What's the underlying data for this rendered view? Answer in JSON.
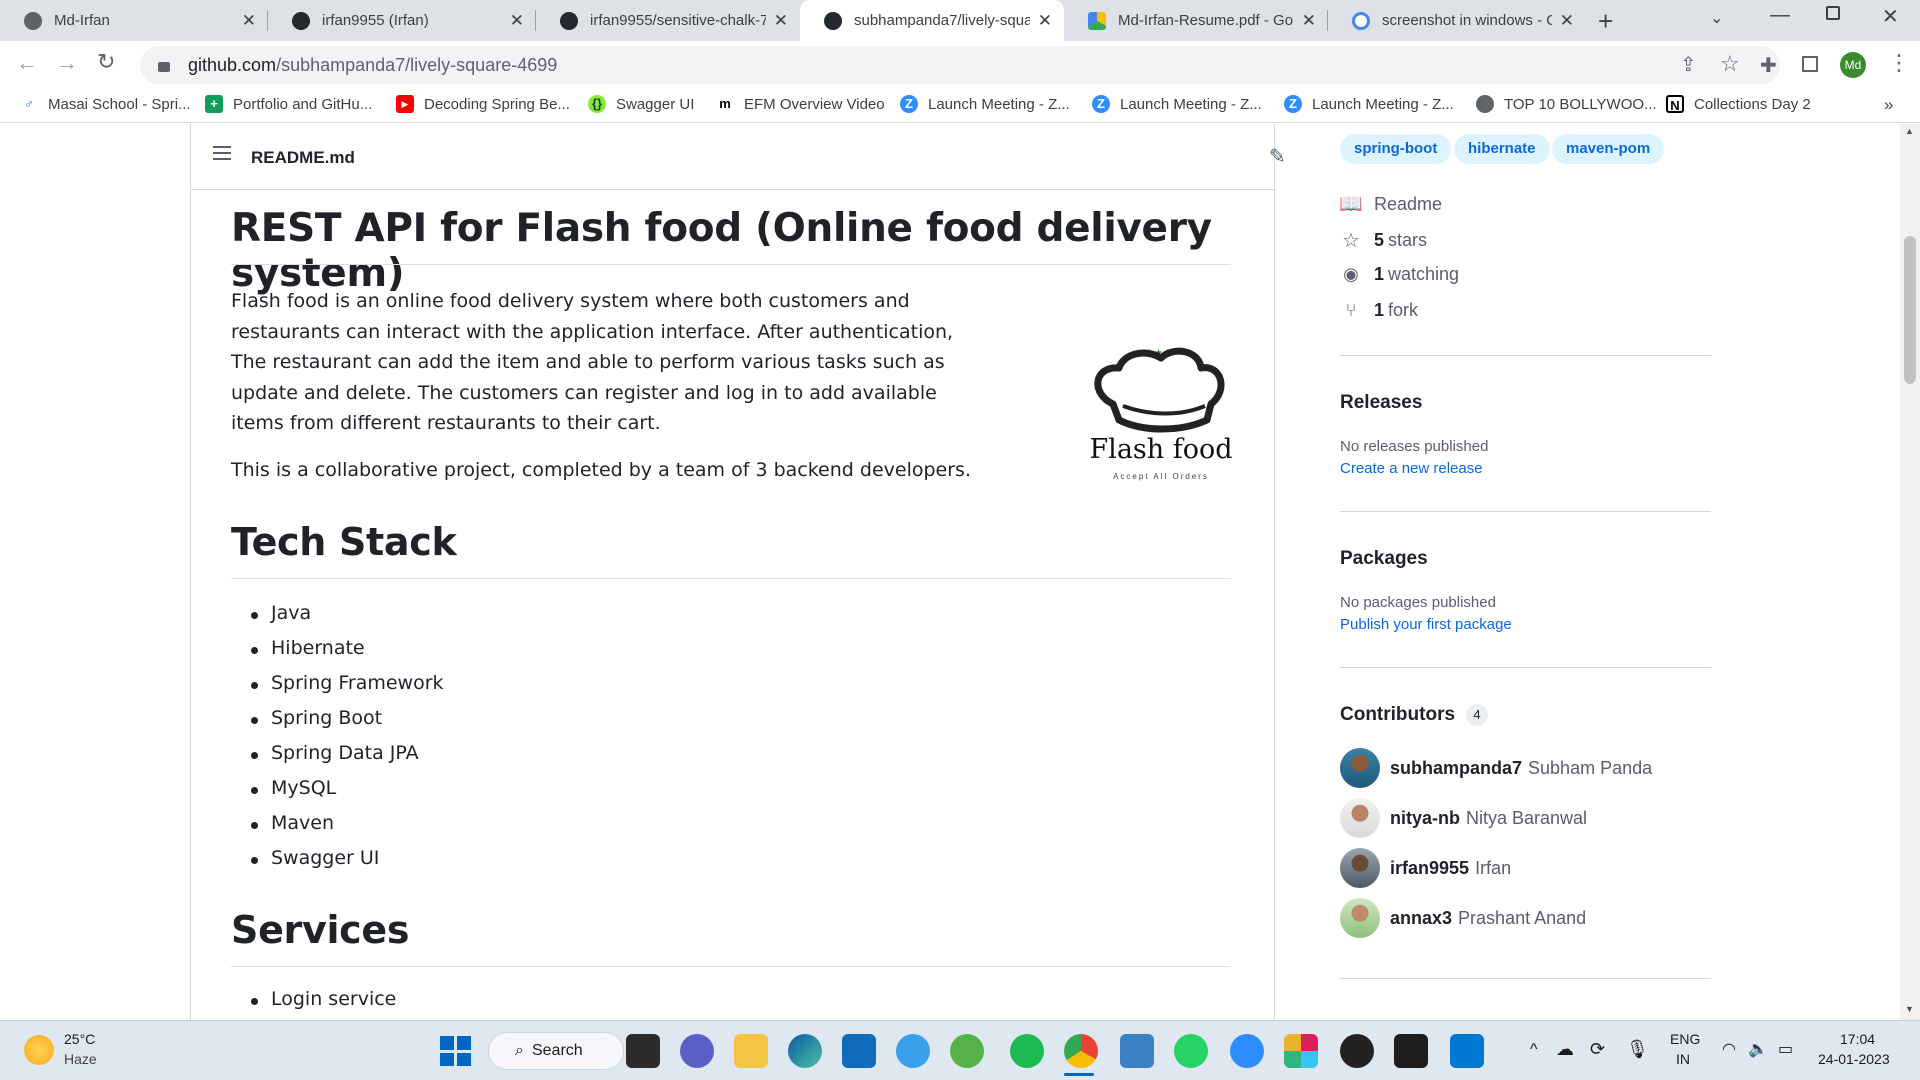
{
  "browser": {
    "tabs": [
      {
        "title": "Md-Irfan"
      },
      {
        "title": "irfan9955 (Irfan)"
      },
      {
        "title": "irfan9955/sensitive-chalk-7("
      },
      {
        "title": "subhampanda7/lively-squar"
      },
      {
        "title": "Md-Irfan-Resume.pdf - Go"
      },
      {
        "title": "screenshot in windows - Go"
      }
    ],
    "new_tab": "+",
    "url_host": "github.com",
    "url_path": "/subhampanda7/lively-square-4699",
    "profile": "Md",
    "bookmarks": [
      "Masai School - Spri...",
      "Portfolio and GitHu...",
      "Decoding Spring Be...",
      "Swagger UI",
      "EFM Overview Video",
      "Launch Meeting - Z...",
      "Launch Meeting - Z...",
      "Launch Meeting - Z...",
      "TOP 10 BOLLYWOO...",
      "Collections Day 2"
    ],
    "more": "»"
  },
  "readme": {
    "filename": "README.md",
    "title": "REST API for Flash food (Online food delivery system)",
    "intro": "Flash food is an online food delivery system where both customers and restaurants can interact with the application interface. After authentication, The restaurant can add the item and able to perform various tasks such as update and delete. The customers can register and log in to add available items from different restaurants to their cart.",
    "collab": "This is a collaborative project, completed by a team of 3 backend developers.",
    "logo_text": "Flash food",
    "logo_tagline": "Accept All Orders",
    "tech_heading": "Tech Stack",
    "tech": [
      "Java",
      "Hibernate",
      "Spring Framework",
      "Spring Boot",
      "Spring Data JPA",
      "MySQL",
      "Maven",
      "Swagger UI"
    ],
    "services_heading": "Services",
    "services": [
      "Login service"
    ]
  },
  "sidebar": {
    "topics": [
      "spring-boot",
      "hibernate",
      "maven-pom"
    ],
    "readme": "Readme",
    "stars_count": "5",
    "stars_label": "stars",
    "watch_count": "1",
    "watch_label": "watching",
    "fork_count": "1",
    "fork_label": "fork",
    "releases_heading": "Releases",
    "releases_none": "No releases published",
    "releases_link": "Create a new release",
    "packages_heading": "Packages",
    "packages_none": "No packages published",
    "packages_link": "Publish your first package",
    "contributors_heading": "Contributors",
    "contributors_count": "4",
    "contributors": [
      {
        "login": "subhampanda7",
        "name": "Subham Panda"
      },
      {
        "login": "nitya-nb",
        "name": "Nitya Baranwal"
      },
      {
        "login": "irfan9955",
        "name": "Irfan"
      },
      {
        "login": "annax3",
        "name": "Prashant Anand"
      }
    ]
  },
  "taskbar": {
    "temp": "25°C",
    "weather": "Haze",
    "search": "Search",
    "lang1": "ENG",
    "lang2": "IN",
    "time": "17:04",
    "date": "24-01-2023"
  },
  "colors": {
    "link": "#0969da",
    "topic_bg": "#ddf4ff",
    "border": "#d0d7de",
    "tabstrip": "#dee1e6"
  }
}
